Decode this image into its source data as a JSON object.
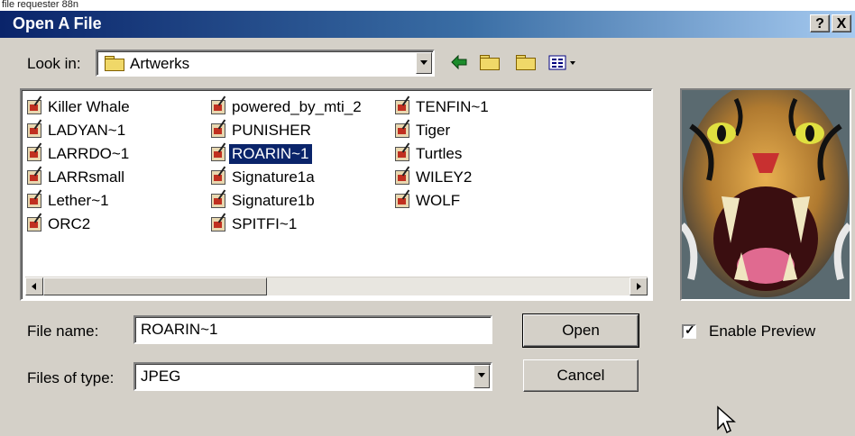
{
  "top_caption": "file requester 88n",
  "window": {
    "title": "Open A File",
    "help_label": "?",
    "close_label": "X"
  },
  "look_in": {
    "label": "Look in:",
    "value": "Artwerks"
  },
  "files": {
    "col1": [
      "Killer Whale",
      "LADYAN~1",
      "LARRDO~1",
      "LARRsmall",
      "Lether~1",
      "ORC2"
    ],
    "col2": [
      "powered_by_mti_2",
      "PUNISHER",
      "ROARIN~1",
      "Signature1a",
      "Signature1b",
      "SPITFI~1"
    ],
    "col3": [
      "TENFIN~1",
      "Tiger",
      "Turtles",
      "WILEY2",
      "WOLF"
    ],
    "selected": "ROARIN~1"
  },
  "file_name": {
    "label": "File name:",
    "value": "ROARIN~1"
  },
  "files_of_type": {
    "label": "Files of type:",
    "value": "JPEG"
  },
  "buttons": {
    "open": "Open",
    "cancel": "Cancel"
  },
  "enable_preview": {
    "label": "Enable Preview",
    "checked": true
  },
  "icons": [
    "folder-icon",
    "back-arrow-icon",
    "up-folder-icon",
    "new-folder-icon",
    "view-menu-icon",
    "image-file-icon",
    "mouse-cursor-icon"
  ]
}
